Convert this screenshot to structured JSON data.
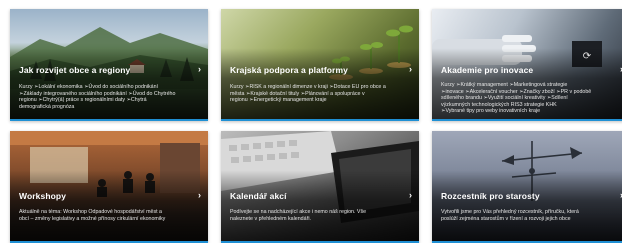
{
  "cards": [
    {
      "title": "Jak rozvíjet obce a regiony",
      "desc": "Kurzy ➢Lokální ekonomika ➢Úvod do sociálního podnikání\n➢Základy integrovaného sociálního podnikání ➢Úvod do Chytrého\nregionu ➢Chytrý(á) práce s regionálními daty ➢Chytrá\ndemografická prognóza",
      "chevron": "›",
      "icon": "chevron-right-icon"
    },
    {
      "title": "Krajská podpora a platformy",
      "desc": "Kurzy ➢RISK a regionální dimenze v kraji ➢Dotace EU pro obce a\nměsta ➢Krajské dotační tituly ➢Plánování a spolupráce v\nregionu ➢Energetický management kraje",
      "chevron": "›",
      "icon": "chevron-right-icon"
    },
    {
      "title": "Akademie pro inovace",
      "desc": "Kurzy ➢Krátký management ➢Marketingová strategie\n➢inovace ➢Akcelerační voucher ➢Značky zboží ➢PR v podobě\nsdíleného brandu ➢Využití sociální kreativity ➢Sdílení\nvýzkumných technologických RIS3 strategie KHK\n➢Vybrané tipy pro weby inovativních kraje",
      "chevron": "›",
      "icon": "chevron-right-icon"
    },
    {
      "title": "Workshopy",
      "desc": "Aktuálně na téma: Workshop Odpadové hospodářství měst a\nobcí – změny legislativy a možné přínosy cirkulární ekonomiky",
      "chevron": "›",
      "icon": "chevron-right-icon"
    },
    {
      "title": "Kalendář akcí",
      "desc": "Podívejte se na nadcházející akce i nemo náš region. Vše\nnaleznete v přehledném kalendáři.",
      "chevron": "›",
      "icon": "chevron-right-icon"
    },
    {
      "title": "Rozcestník pro starosty",
      "desc": "Vytvořili jsme pro Vás přehledný rozcestník, příručku, která\nposlúží zejména starostům v řízení a rozvoji jejich obce",
      "chevron": "›",
      "icon": "chevron-right-icon"
    }
  ],
  "colors": {
    "accent": "#1f8fd3"
  }
}
